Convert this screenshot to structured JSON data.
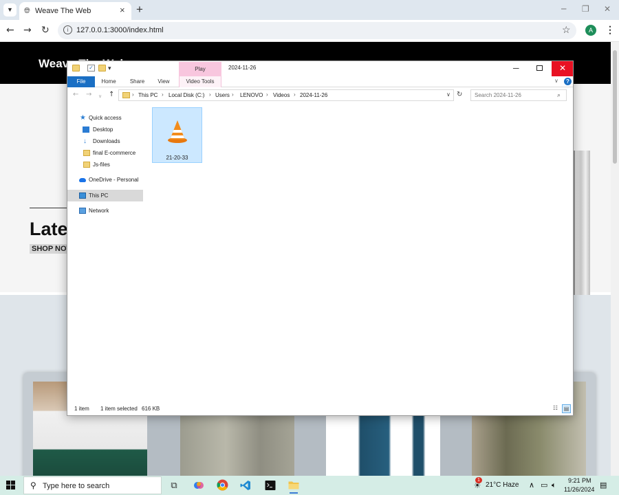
{
  "browser": {
    "tab_title": "Weave The Web",
    "tab_close": "×",
    "new_tab": "+",
    "url": "127.0.0.1:3000/index.html",
    "window_controls": {
      "minimize": "─",
      "restore": "❐",
      "close": "✕"
    },
    "nav": {
      "back": "←",
      "forward": "→",
      "reload": "↻"
    },
    "bookmark_icon": "☆",
    "profile_initial": "A",
    "menu_icon": "⋮"
  },
  "website": {
    "logo": "Weave The Web",
    "hero_title": "Latest",
    "shop_button": "SHOP NOW"
  },
  "explorer": {
    "title": "2024-11-26",
    "context_tab": "Play",
    "ribbon_tabs": [
      "File",
      "Home",
      "Share",
      "View",
      "Video Tools"
    ],
    "window_controls": {
      "minimize": "─",
      "close": "✕"
    },
    "breadcrumb": [
      "This PC",
      "Local Disk (C:)",
      "Users",
      "LENOVO",
      "Videos",
      "2024-11-26"
    ],
    "search_placeholder": "Search 2024-11-26",
    "sidebar": [
      {
        "label": "Quick access",
        "icon": "star-icon"
      },
      {
        "label": "Desktop",
        "icon": "desktop-icon"
      },
      {
        "label": "Downloads",
        "icon": "download-icon"
      },
      {
        "label": "final E-commerce",
        "icon": "folder-icon"
      },
      {
        "label": "Js-files",
        "icon": "folder-icon"
      },
      {
        "label": "OneDrive - Personal",
        "icon": "cloud-icon"
      },
      {
        "label": "This PC",
        "icon": "computer-icon"
      },
      {
        "label": "Network",
        "icon": "network-icon"
      }
    ],
    "files": [
      {
        "name": "21-20-33",
        "icon": "vlc-icon"
      }
    ],
    "status": {
      "count": "1 item",
      "selected": "1 item selected",
      "size": "616 KB"
    }
  },
  "taskbar": {
    "search_placeholder": "Type here to search",
    "weather": "21°C  Haze",
    "time": "9:21 PM",
    "date": "11/26/2024",
    "notification_badge": "1"
  },
  "colors": {
    "accent_blue": "#1a6fc4",
    "close_red": "#e81123",
    "video_tools_pink": "#f8c6de",
    "selection_blue": "#cce8ff",
    "taskbar": "#d5ede6"
  }
}
